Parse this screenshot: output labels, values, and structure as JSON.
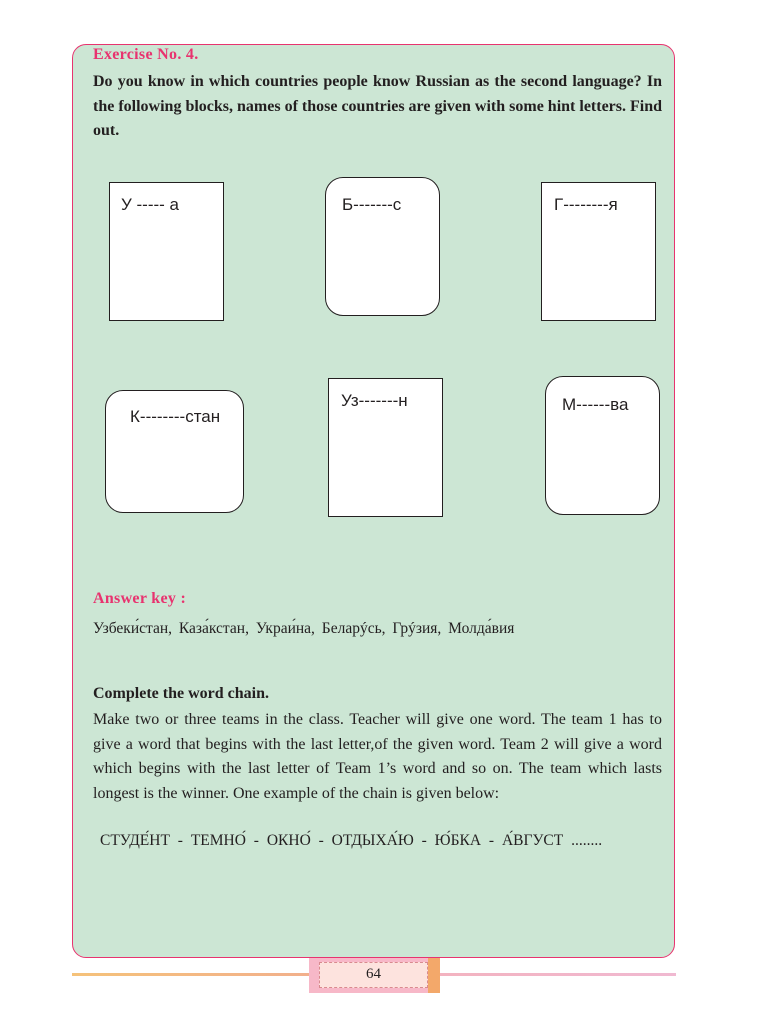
{
  "exercise": {
    "title": "Exercise No. 4.",
    "intro": "Do you know in which countries people know Russian as the second language? In the following blocks, names of those countries are given with some hint letters. Find out."
  },
  "hint_boxes": [
    {
      "label": "У ----- а"
    },
    {
      "label": "Б-------с"
    },
    {
      "label": "Г--------я"
    },
    {
      "label": "К--------стан"
    },
    {
      "label": "Уз-------н"
    },
    {
      "label": "М------ва"
    }
  ],
  "answer_key": {
    "title": "Answer key :",
    "text": "Узбеки́стан, Каза́кстан, Украи́на, Беларýсь, Грýзия, Молда́вия"
  },
  "word_chain": {
    "title": "Complete the word chain.",
    "text": "Make two or three teams in the class. Teacher will give one word. The team 1 has to give a word that begins with the last letter,of the given word. Team 2 will give a word which begins with the last letter of Team 1’s word and so on. The team which lasts longest is the winner. One example of the chain is given below:",
    "example": "СТУДЕ́НТ - ТЕМНО́ - ОКНО́ - ОТДЫХА́Ю - Ю́БКА - А́ВГУСТ ........"
  },
  "footer": {
    "page_number": "64"
  },
  "colors": {
    "panel_bg": "#cce6d4",
    "accent": "#e8336f"
  }
}
